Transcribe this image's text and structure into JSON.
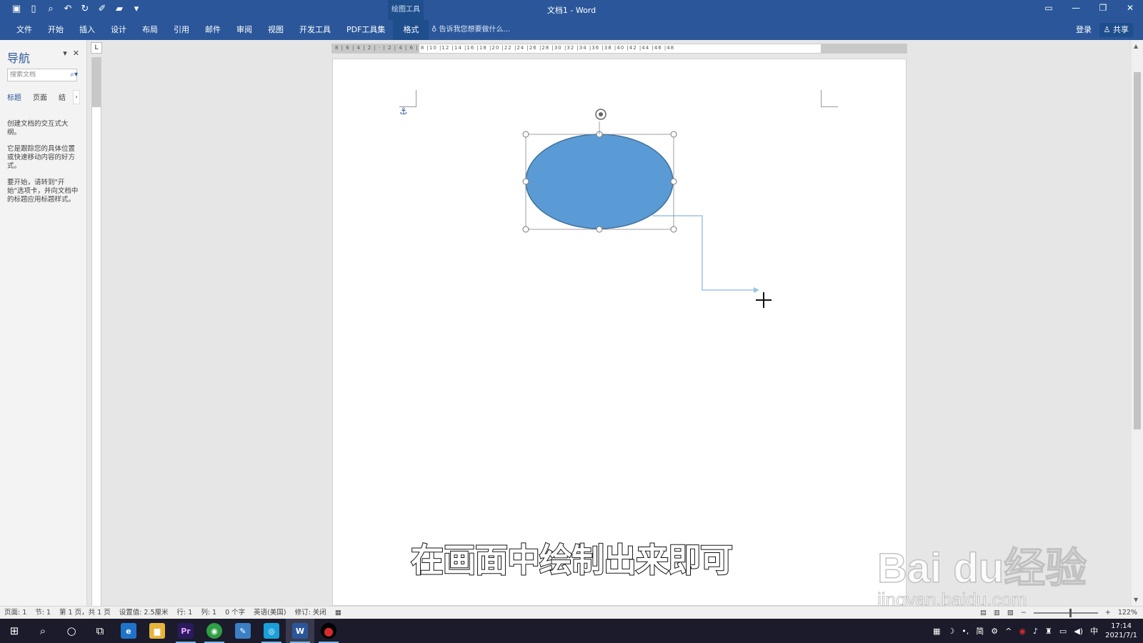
{
  "window": {
    "title": "文档1 - Word",
    "context_group": "绘图工具",
    "controls": [
      "▭",
      "—",
      "❐",
      "✕"
    ]
  },
  "quick_access": [
    "save-icon",
    "new-document-icon",
    "print-preview-icon",
    "undo-icon",
    "redo-icon",
    "format-painter-icon",
    "open-icon",
    "customize-icon"
  ],
  "ribbon": {
    "tabs": [
      "文件",
      "开始",
      "插入",
      "设计",
      "布局",
      "引用",
      "邮件",
      "审阅",
      "视图",
      "开发工具",
      "PDF工具集",
      "格式"
    ],
    "active_tab": "格式",
    "tell_me": "告诉我您想要做什么...",
    "login": "登录",
    "share": "共享"
  },
  "nav_pane": {
    "title": "导航",
    "search_placeholder": "搜索文档",
    "tabs": [
      "标题",
      "页面",
      "结"
    ],
    "paragraphs": [
      "创建文档的交互式大纲。",
      "它是跟踪您的具体位置或快速移动内容的好方式。",
      "要开始，请转到\"开始\"选项卡，并向文档中的标题应用标题样式。"
    ]
  },
  "ruler": {
    "tab_selector": "L",
    "h_labels": "8 | 6 | 4 | 2 | · | 2 | 4 | 6 | 8 |10 |12 |14 |16 |18 |20 |22 |24 |26 |28 |30 |32 |34 |36 |38 |40 |42 |44 |46 |48"
  },
  "document": {
    "subtitle": "在画面中绘制出来即可",
    "shape_fill": "#5b9bd5",
    "shape_stroke": "#41719c",
    "connector_color": "#9dc3e6"
  },
  "watermark": {
    "brand": "Bai du经验",
    "url": "jingyan.baidu.com"
  },
  "status_bar": {
    "items": [
      "页面: 1",
      "节: 1",
      "第 1 页，共 1 页",
      "设置值: 2.5厘米",
      "行: 1",
      "列: 1",
      "0 个字",
      "英语(美国)",
      "修订: 关闭"
    ],
    "zoom": "122%",
    "zoom_minus": "−",
    "zoom_plus": "+"
  },
  "taskbar": {
    "apps": [
      {
        "name": "edge",
        "glyph": "e",
        "color": "#1f74c9"
      },
      {
        "name": "file-explorer",
        "glyph": "▆",
        "color": "#e7b53b"
      },
      {
        "name": "premiere",
        "glyph": "Pr",
        "color": "#2a1a5e"
      },
      {
        "name": "chrome",
        "glyph": "◉",
        "color": "#2f9e44"
      },
      {
        "name": "notes",
        "glyph": "✎",
        "color": "#3b7fc4"
      },
      {
        "name": "messenger",
        "glyph": "◎",
        "color": "#1a9fd8"
      },
      {
        "name": "word",
        "glyph": "W",
        "color": "#2b579a"
      },
      {
        "name": "recorder",
        "glyph": "●",
        "color": "#d92b2b"
      }
    ],
    "tray_text": "中",
    "tray_ime": "简",
    "time": "17:14",
    "date": "2021/7/1"
  }
}
